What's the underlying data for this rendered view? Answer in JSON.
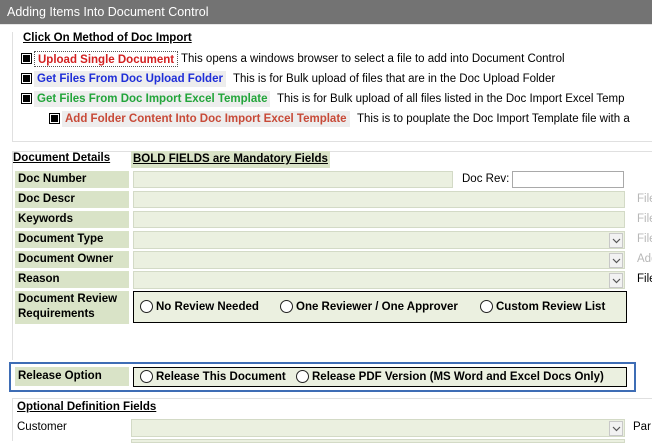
{
  "window": {
    "title": "Adding Items Into Document Control"
  },
  "import": {
    "title": "Click On Method of Doc Import",
    "options": [
      {
        "label": "Upload Single Document",
        "color": "#d22020",
        "description": "This opens a windows browser to select a file to add into Document Control"
      },
      {
        "label": "Get Files From Doc Upload Folder",
        "color": "#1f2ed8",
        "description": "This is for Bulk upload of files that are in the Doc Upload Folder"
      },
      {
        "label": "Get Files From Doc Import Excel Template",
        "color": "#22a53a",
        "description": "This is for Bulk upload of all files listed in the Doc Import Excel Temp"
      },
      {
        "label": "Add Folder Content Into Doc Import Excel Template",
        "color": "#c84a38",
        "description": "This is to pouplate the Doc Import Template file with a"
      }
    ]
  },
  "details": {
    "header": "Document Details",
    "mandatory_note": "BOLD FIELDS are Mandatory Fields",
    "doc_number_label": "Doc Number",
    "doc_rev_label": "Doc Rev:",
    "doc_descr_label": "Doc Descr",
    "keywords_label": "Keywords",
    "document_type_label": "Document Type",
    "document_owner_label": "Document Owner",
    "reason_label": "Reason",
    "side_labels": [
      "File",
      "File",
      "File",
      "Add",
      "File"
    ],
    "review_label_line1": "Document Review",
    "review_label_line2": "Requirements",
    "review_options": [
      "No Review Needed",
      "One Reviewer / One Approver",
      "Custom Review List"
    ]
  },
  "release": {
    "label": "Release Option",
    "options": [
      "Release This Document",
      "Release PDF Version (MS Word and Excel Docs Only)"
    ],
    "highlight_color": "#3e6db5"
  },
  "optional": {
    "header": "Optional Definition Fields",
    "customer_label": "Customer",
    "right_label": "Par"
  }
}
